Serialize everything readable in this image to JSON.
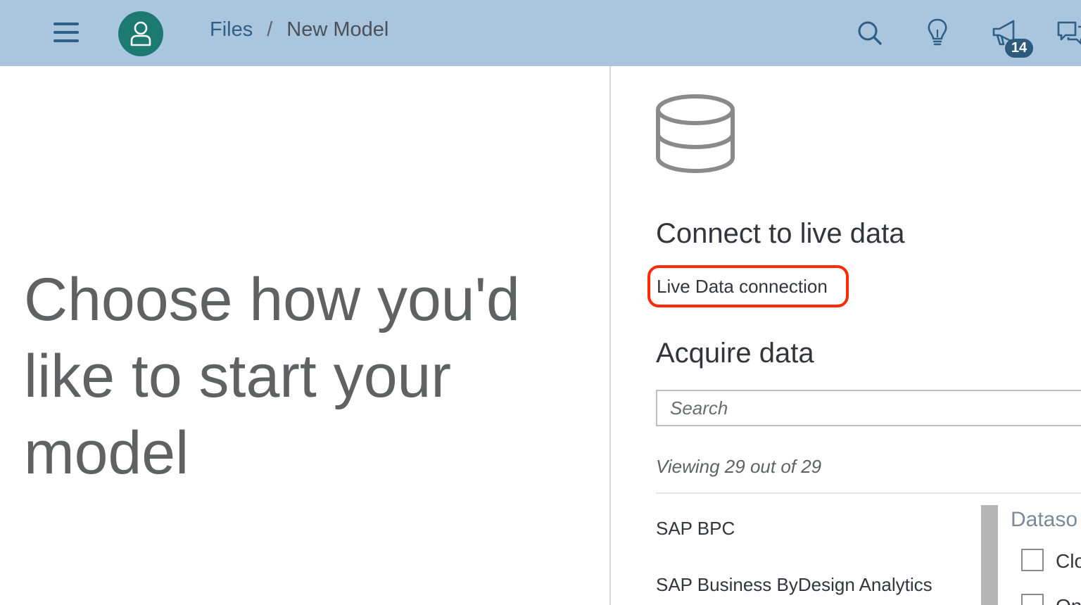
{
  "header": {
    "breadcrumb": {
      "root": "Files",
      "separator": "/",
      "current": "New Model"
    },
    "notification_count": "14",
    "icons": [
      "menu-icon",
      "user-icon",
      "search-icon",
      "lightbulb-icon",
      "megaphone-icon",
      "chat-icon"
    ],
    "colors": {
      "bar": "#a9c6de",
      "avatar": "#1c7a73",
      "badge": "#2e5a7e"
    }
  },
  "main": {
    "heading": "Choose how you'd like to start your model"
  },
  "right_panel": {
    "icon": "database-icon",
    "live_title": "Connect to live data",
    "live_link": "Live Data connection",
    "acquire_title": "Acquire data",
    "search_placeholder": "Search",
    "viewing": "Viewing 29 out of 29",
    "sources": [
      "SAP BPC",
      "SAP Business ByDesign Analytics"
    ],
    "filter": {
      "header": "Dataso",
      "options": [
        "Clo",
        "On"
      ]
    },
    "highlight_color": "#ff2a00"
  }
}
